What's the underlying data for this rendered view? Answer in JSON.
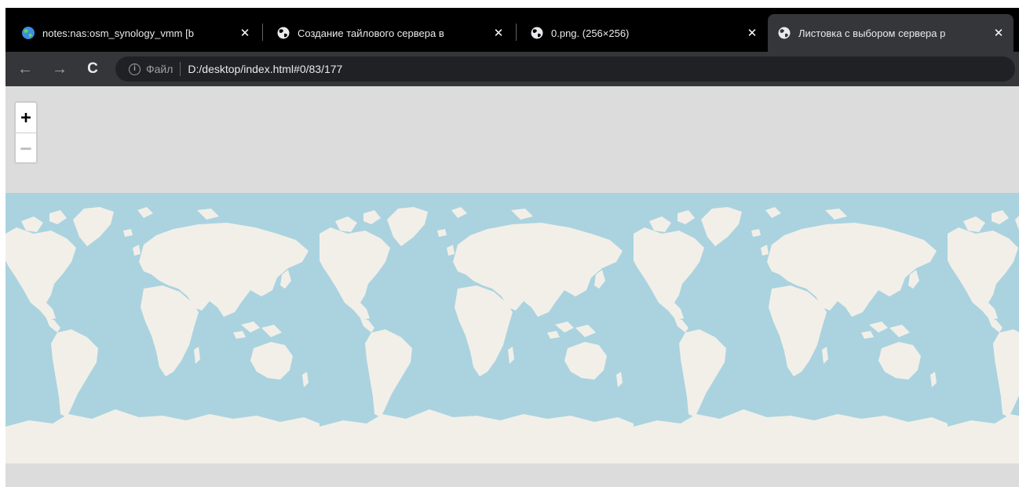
{
  "tabs": [
    {
      "title": "notes:nas:osm_synology_vmm [b",
      "favicon": "globe-blue-icon",
      "active": false
    },
    {
      "title": "Создание тайлового сервера в",
      "favicon": "globe-icon",
      "active": false
    },
    {
      "title": "0.png. (256×256)",
      "favicon": "globe-icon",
      "active": false
    },
    {
      "title": "Листовка с выбором сервера р",
      "favicon": "globe-icon",
      "active": true
    }
  ],
  "tab_close_glyph": "✕",
  "toolbar": {
    "back_glyph": "←",
    "forward_glyph": "→",
    "reload_glyph": "C",
    "info_glyph": "i",
    "scheme_label": "Файл",
    "url": "D:/desktop/index.html#0/83/177"
  },
  "map": {
    "zoom_in_label": "+",
    "zoom_out_label": "—",
    "ocean_color": "#aad3df",
    "land_color": "#f2efe9",
    "background_color": "#dcdcdc"
  }
}
